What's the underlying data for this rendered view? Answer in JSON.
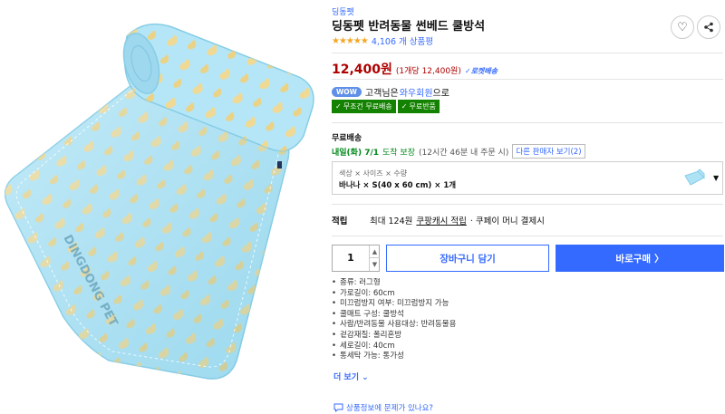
{
  "product": {
    "brand": "딩동펫",
    "title": "딩동펫 반려동물 썬베드 쿨방석",
    "stars": "★★★★★",
    "rating_count": "4,106 개 상품평",
    "rating_value": 4.5,
    "wishlist_icon": "heart-icon",
    "share_icon": "share-icon",
    "image_text": "DINGDONG PET"
  },
  "price": {
    "amount": "12,400원",
    "unit_price": "(1개당 12,400원)",
    "rocket_label": "✓로켓배송"
  },
  "membership": {
    "badge": "WOW",
    "text_prefix": "고객님은",
    "link": "와우회원",
    "text_suffix": "으로",
    "badges": [
      "무조건 무료배송",
      "무료반품"
    ]
  },
  "shipping": {
    "title": "무료배송",
    "date": "내일(화) 7/1",
    "guarantee": "도착 보장",
    "note": "(12시간 46분 내 주문 시)",
    "other_sellers": "다른 판매자 보기(2)"
  },
  "option": {
    "header": "색상 × 사이즈 × 수량",
    "value": "바나나 × S(40 x 60 cm) × 1개",
    "arrow": "▼"
  },
  "reward": {
    "label": "적립",
    "text": "최대 124원",
    "link": "쿠팡캐시 적립",
    "suffix": "· 쿠페이 머니 결제시"
  },
  "purchase": {
    "quantity": "1",
    "cart_label": "장바구니 담기",
    "buy_label": "바로구매",
    "buy_arrow": "〉"
  },
  "attributes": [
    "종류: 러그형",
    "가로길이: 60cm",
    "미끄럼방지 여부: 미끄럼방지 가능",
    "쿨매트 구성: 쿨방석",
    "사람/반려동물 사용대상: 반려동물용",
    "겉감재질: 폴리혼방",
    "세로길이: 40cm",
    "통세탁 가능: 통가성"
  ],
  "more_label": "더 보기",
  "report_label": "상품정보에 문제가 있나요?",
  "colors": {
    "accent_blue": "#346aff",
    "price_red": "#ae0000",
    "delivery_green": "#00891a",
    "badge_green": "#138200",
    "mat_blue": "#aee3f5"
  }
}
